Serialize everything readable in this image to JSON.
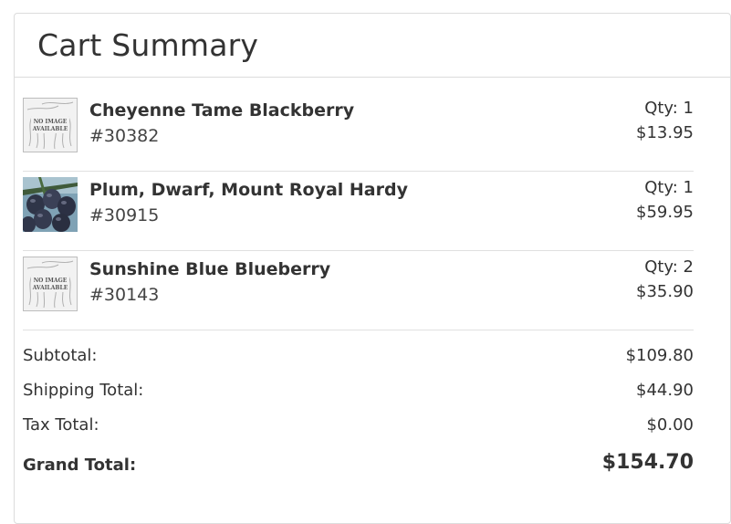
{
  "summary": {
    "title": "Cart Summary"
  },
  "items": [
    {
      "name": "Cheyenne Tame Blackberry",
      "sku": "#30382",
      "qty": "Qty: 1",
      "price": "$13.95",
      "image": "no-image-available",
      "no_image_line1": "NO IMAGE",
      "no_image_line2": "AVAILABLE"
    },
    {
      "name": "Plum, Dwarf, Mount Royal Hardy",
      "sku": "#30915",
      "qty": "Qty: 1",
      "price": "$59.95",
      "image": "plum-photo"
    },
    {
      "name": "Sunshine Blue Blueberry",
      "sku": "#30143",
      "qty": "Qty: 2",
      "price": "$35.90",
      "image": "no-image-available",
      "no_image_line1": "NO IMAGE",
      "no_image_line2": "AVAILABLE"
    }
  ],
  "totals": {
    "subtotal_label": "Subtotal:",
    "subtotal_value": "$109.80",
    "shipping_label": "Shipping Total:",
    "shipping_value": "$44.90",
    "tax_label": "Tax Total:",
    "tax_value": "$0.00",
    "grand_label": "Grand Total:",
    "grand_value": "$154.70"
  },
  "colors": {
    "text": "#333333",
    "border": "#dcdcdc",
    "background": "#ffffff"
  }
}
